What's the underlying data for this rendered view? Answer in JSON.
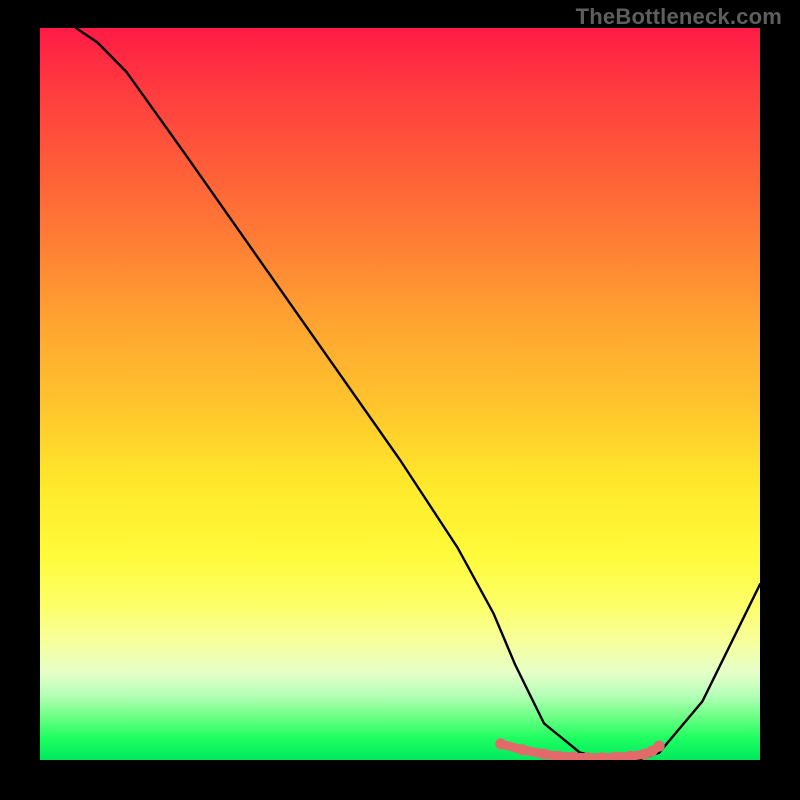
{
  "watermark": "TheBottleneck.com",
  "chart_data": {
    "type": "line",
    "title": "",
    "xlabel": "",
    "ylabel": "",
    "xlim": [
      0,
      100
    ],
    "ylim": [
      0,
      100
    ],
    "grid": false,
    "legend": false,
    "series": [
      {
        "name": "curve",
        "color": "#000000",
        "x": [
          5,
          8,
          12,
          20,
          30,
          40,
          50,
          58,
          63,
          66,
          70,
          75,
          80,
          83,
          86,
          92,
          100
        ],
        "y": [
          100,
          98,
          94,
          83,
          69,
          55,
          41,
          29,
          20,
          13,
          5,
          1,
          0,
          0,
          1,
          8,
          24
        ]
      }
    ],
    "markers": {
      "name": "bottom-markers",
      "color": "#e26a6a",
      "x": [
        64,
        67,
        70,
        72,
        74,
        76,
        78,
        80,
        82,
        84,
        85,
        86
      ],
      "y": [
        2.2,
        1.4,
        0.8,
        0.5,
        0.4,
        0.3,
        0.3,
        0.4,
        0.5,
        0.8,
        1.2,
        1.9
      ]
    },
    "background_gradient": {
      "type": "vertical",
      "stops": [
        {
          "pos": 0.0,
          "color": "#ff1b46"
        },
        {
          "pos": 0.5,
          "color": "#ffc62d"
        },
        {
          "pos": 0.8,
          "color": "#fdff69"
        },
        {
          "pos": 0.94,
          "color": "#6fff86"
        },
        {
          "pos": 1.0,
          "color": "#00e85e"
        }
      ]
    }
  }
}
